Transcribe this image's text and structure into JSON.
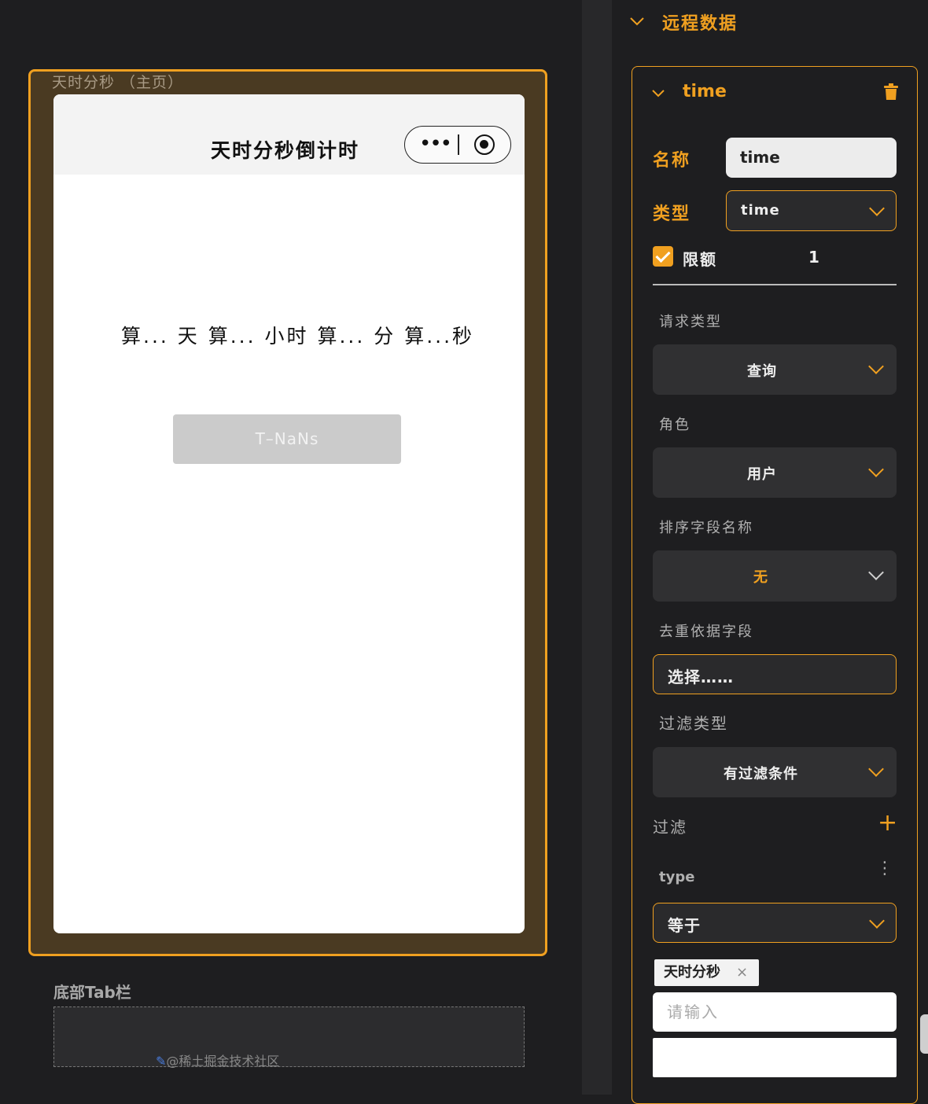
{
  "canvas": {
    "page_label": "天时分秒 （主页）",
    "nav_title": "天时分秒倒计时",
    "capsule_more": "•••",
    "countdown_text": "算... 天 算... 小时 算... 分 算...秒",
    "button_label": "T–NaNs",
    "tabbar_label": "底部Tab栏"
  },
  "panel": {
    "section_title": "远程数据",
    "item_title": "time",
    "name_label": "名称",
    "name_value": "time",
    "type_label": "类型",
    "type_value": "time",
    "limit_label": "限额",
    "limit_value": "1",
    "request_type_label": "请求类型",
    "request_type_value": "查询",
    "role_label": "角色",
    "role_value": "用户",
    "sort_field_label": "排序字段名称",
    "sort_field_value": "无",
    "dedupe_label": "去重依据字段",
    "dedupe_placeholder": "选择……",
    "filter_type_label": "过滤类型",
    "filter_type_value": "有过滤条件",
    "filter_label": "过滤",
    "filter_add": "+",
    "condition_field": "type",
    "condition_kebab": "⋮",
    "operator_value": "等于",
    "tag_value": "天时分秒",
    "tag_close": "×",
    "input_placeholder": "请输入"
  },
  "watermark": {
    "icon": "✎",
    "text": "@稀土掘金技术社区"
  },
  "colors": {
    "accent": "#f0a020",
    "background": "#1e1e20",
    "frame_fill": "#4a3a22"
  }
}
